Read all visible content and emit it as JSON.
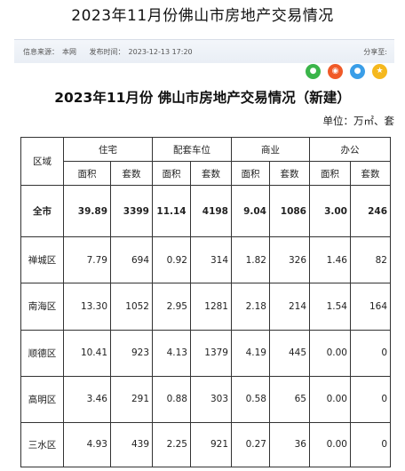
{
  "page": {
    "title": "2023年11月份佛山市房地产交易情况",
    "source_label": "信息来源：",
    "source": "本网",
    "time_label": "发布时间：",
    "time": "2023-12-13 17:20",
    "share_label": "分享至:"
  },
  "share": [
    {
      "name": "wechat-icon",
      "color": "#3bb54a",
      "glyph": "●"
    },
    {
      "name": "weibo-icon",
      "color": "#f05a28",
      "glyph": "◉"
    },
    {
      "name": "qq-icon",
      "color": "#3a9ee8",
      "glyph": "●"
    },
    {
      "name": "qzone-icon",
      "color": "#f5b81e",
      "glyph": "★"
    }
  ],
  "document": {
    "heading": "2023年11月份 佛山市房地产交易情况（新建）",
    "unit": "单位：万㎡、套"
  },
  "table": {
    "region_header": "区域",
    "groups": [
      "住宅",
      "配套车位",
      "商业",
      "办公"
    ],
    "sub_headers": [
      "面积",
      "套数",
      "面积",
      "套数",
      "面积",
      "套数",
      "面积",
      "套数"
    ],
    "rows": [
      {
        "region": "全市",
        "cells": [
          "39.89",
          "3399",
          "11.14",
          "4198",
          "9.04",
          "1086",
          "3.00",
          "246"
        ]
      },
      {
        "region": "禅城区",
        "cells": [
          "7.79",
          "694",
          "0.92",
          "314",
          "1.82",
          "326",
          "1.46",
          "82"
        ]
      },
      {
        "region": "南海区",
        "cells": [
          "13.30",
          "1052",
          "2.95",
          "1281",
          "2.18",
          "214",
          "1.54",
          "164"
        ]
      },
      {
        "region": "顺德区",
        "cells": [
          "10.41",
          "923",
          "4.13",
          "1379",
          "4.19",
          "445",
          "0.00",
          "0"
        ]
      },
      {
        "region": "高明区",
        "cells": [
          "3.46",
          "291",
          "0.88",
          "303",
          "0.58",
          "65",
          "0.00",
          "0"
        ]
      },
      {
        "region": "三水区",
        "cells": [
          "4.93",
          "439",
          "2.25",
          "921",
          "0.27",
          "36",
          "0.00",
          "0"
        ]
      }
    ]
  }
}
